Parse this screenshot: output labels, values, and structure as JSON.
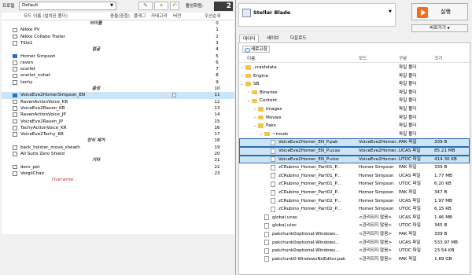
{
  "profile": {
    "label": "프로필",
    "value": "Default"
  },
  "active": {
    "label": "활성화됨:",
    "count": "2"
  },
  "mod_columns": {
    "name": "모드 이름 (설치된 폴더)",
    "conflicts": "충돌(중첩)",
    "flags": "플래그",
    "category": "카테고리",
    "version": "버전",
    "priority": "우선순위"
  },
  "mods": [
    {
      "type": "sep",
      "name": "타이틀",
      "priority": "0"
    },
    {
      "type": "mod",
      "name": "Nikke PV",
      "checked": false,
      "priority": "1"
    },
    {
      "type": "mod",
      "name": "Nikke Collabo Trailer",
      "checked": false,
      "priority": "2"
    },
    {
      "type": "mod",
      "name": "Title1",
      "checked": false,
      "priority": "3"
    },
    {
      "type": "sep",
      "name": "얼굴",
      "priority": "4"
    },
    {
      "type": "mod",
      "name": "Homer Simpson",
      "checked": true,
      "priority": "5"
    },
    {
      "type": "mod",
      "name": "raven",
      "checked": false,
      "priority": "6"
    },
    {
      "type": "mod",
      "name": "scarlet",
      "checked": false,
      "priority": "7"
    },
    {
      "type": "mod",
      "name": "scarlet_nohat",
      "checked": false,
      "priority": "8"
    },
    {
      "type": "mod",
      "name": "tachy",
      "checked": false,
      "priority": "9"
    },
    {
      "type": "sep",
      "name": "음성",
      "priority": "10"
    },
    {
      "type": "mod",
      "name": "VoiceEve2HomerSimpson_EN",
      "checked": true,
      "priority": "11",
      "selected": true
    },
    {
      "type": "mod",
      "name": "RavenActionVoice_KR",
      "checked": false,
      "priority": "12"
    },
    {
      "type": "mod",
      "name": "VoiceEve2Raven_KR",
      "checked": false,
      "priority": "13"
    },
    {
      "type": "mod",
      "name": "RavenActionVoice_JP",
      "checked": false,
      "priority": "14"
    },
    {
      "type": "mod",
      "name": "VoiceEve2Raven_JP",
      "checked": false,
      "priority": "15"
    },
    {
      "type": "mod",
      "name": "TachyActionVoice_KR",
      "checked": false,
      "priority": "16"
    },
    {
      "type": "mod",
      "name": "VoiceEve2Tachy_KR",
      "checked": false,
      "priority": "17"
    },
    {
      "type": "sep",
      "name": "장식 제거",
      "priority": "18"
    },
    {
      "type": "mod",
      "name": "back_holster_move_sheath",
      "checked": false,
      "priority": "19"
    },
    {
      "type": "mod",
      "name": "All Suits Zero Shield",
      "checked": false,
      "priority": "20"
    },
    {
      "type": "sep",
      "name": "기타",
      "priority": "21"
    },
    {
      "type": "mod",
      "name": "doro_pet",
      "checked": false,
      "priority": "22"
    },
    {
      "type": "mod",
      "name": "VergilChair",
      "checked": false,
      "priority": "23"
    },
    {
      "type": "overwrite",
      "name": "Overwrite",
      "priority": ""
    }
  ],
  "game": {
    "name": "Stellar Blade"
  },
  "run": {
    "label": "실행"
  },
  "shortcut": {
    "label": "바로가기"
  },
  "tabs": [
    "데이터",
    "세이브",
    "다운로드"
  ],
  "refresh": {
    "label": "새로고침"
  },
  "tree_columns": {
    "name": "이름",
    "mod": "모드",
    "type": "구분",
    "size": "크기"
  },
  "tree": [
    {
      "level": 0,
      "tw": "›",
      "kind": "folder",
      "name": ".crashdata",
      "mod": "",
      "type": "파일 폴더",
      "size": ""
    },
    {
      "level": 0,
      "tw": "›",
      "kind": "folder",
      "name": "Engine",
      "mod": "",
      "type": "파일 폴더",
      "size": ""
    },
    {
      "level": 0,
      "tw": "⌄",
      "kind": "folder",
      "name": "SB",
      "mod": "",
      "type": "파일 폴더",
      "size": ""
    },
    {
      "level": 1,
      "tw": "›",
      "kind": "folder",
      "name": "Binaries",
      "mod": "",
      "type": "파일 폴더",
      "size": ""
    },
    {
      "level": 1,
      "tw": "⌄",
      "kind": "folder",
      "name": "Content",
      "mod": "",
      "type": "파일 폴더",
      "size": ""
    },
    {
      "level": 2,
      "tw": "›",
      "kind": "folder",
      "name": "Images",
      "mod": "",
      "type": "파일 폴더",
      "size": ""
    },
    {
      "level": 2,
      "tw": "›",
      "kind": "folder",
      "name": "Movies",
      "mod": "",
      "type": "파일 폴더",
      "size": ""
    },
    {
      "level": 2,
      "tw": "⌄",
      "kind": "folder",
      "name": "Paks",
      "mod": "",
      "type": "파일 폴더",
      "size": ""
    },
    {
      "level": 3,
      "tw": "⌄",
      "kind": "folder",
      "name": "~mods",
      "mod": "",
      "type": "파일 폴더",
      "size": ""
    },
    {
      "level": 4,
      "tw": "",
      "kind": "file",
      "name": "VoiceEve2Homer_EN_P.pak",
      "mod": "VoiceEve2Homer...",
      "type": "PAK 파일",
      "size": "339 B",
      "hl": true
    },
    {
      "level": 4,
      "tw": "",
      "kind": "file",
      "name": "VoiceEve2Homer_EN_P.ucas",
      "mod": "VoiceEve2Homer...",
      "type": "UCAS 파일",
      "size": "85.21 MB",
      "hl": true
    },
    {
      "level": 4,
      "tw": "",
      "kind": "file",
      "name": "VoiceEve2Homer_EN_P.utoc",
      "mod": "VoiceEve2Homer...",
      "type": "UTOC 파일",
      "size": "414.30 KB",
      "hl": true
    },
    {
      "level": 4,
      "tw": "",
      "kind": "file",
      "name": "zCRubino_Homer_Part01_P...",
      "mod": "Homer Simpson",
      "type": "PAK 파일",
      "size": "339 B"
    },
    {
      "level": 4,
      "tw": "",
      "kind": "file",
      "name": "zCRubino_Homer_Part01_P...",
      "mod": "Homer Simpson",
      "type": "UCAS 파일",
      "size": "1.77 MB"
    },
    {
      "level": 4,
      "tw": "",
      "kind": "file",
      "name": "zCRubino_Homer_Part01_P...",
      "mod": "Homer Simpson",
      "type": "UTOC 파일",
      "size": "6.20 KB"
    },
    {
      "level": 4,
      "tw": "",
      "kind": "file",
      "name": "zCRubino_Homer_Part02_P...",
      "mod": "Homer Simpson",
      "type": "PAK 파일",
      "size": "347 B"
    },
    {
      "level": 4,
      "tw": "",
      "kind": "file",
      "name": "zCRubino_Homer_Part02_P...",
      "mod": "Homer Simpson",
      "type": "UCAS 파일",
      "size": "1.97 MB"
    },
    {
      "level": 4,
      "tw": "",
      "kind": "file",
      "name": "zCRubino_Homer_Part02_P...",
      "mod": "Homer Simpson",
      "type": "UTOC 파일",
      "size": "6.15 KB"
    },
    {
      "level": 3,
      "tw": "",
      "kind": "file",
      "name": "global.ucas",
      "mod": "<관리되지 않음>",
      "type": "UCAS 파일",
      "size": "1.46 MB"
    },
    {
      "level": 3,
      "tw": "",
      "kind": "file",
      "name": "global.utoc",
      "mod": "<관리되지 않음>",
      "type": "UTOC 파일",
      "size": "345 B"
    },
    {
      "level": 3,
      "tw": "",
      "kind": "file",
      "name": "pakchunk0optional-Windows...",
      "mod": "<관리되지 않음>",
      "type": "PAK 파일",
      "size": "339 B"
    },
    {
      "level": 3,
      "tw": "",
      "kind": "file",
      "name": "pakchunk0optional-Windows...",
      "mod": "<관리되지 않음>",
      "type": "UCAS 파일",
      "size": "533.97 MB"
    },
    {
      "level": 3,
      "tw": "",
      "kind": "file",
      "name": "pakchunk0optional-Windows...",
      "mod": "<관리되지 않음>",
      "type": "UTOC 파일",
      "size": "23.54 KB"
    },
    {
      "level": 3,
      "tw": "",
      "kind": "file",
      "name": "pakchunk0-WindowsNoEditor.pak",
      "mod": "<관리되지 않음>",
      "type": "PAK 파일",
      "size": "1.89 GB"
    }
  ]
}
